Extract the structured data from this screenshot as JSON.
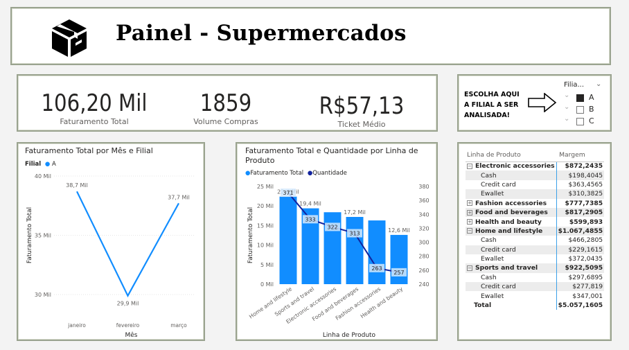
{
  "header": {
    "title": "Painel - Supermercados",
    "logo_icon": "package-box-icon"
  },
  "kpis": [
    {
      "value": "106,20 Mil",
      "label": "Faturamento Total"
    },
    {
      "value": "1859",
      "label": "Volume Compras"
    },
    {
      "value": "R$57,13",
      "label": "Ticket Médio"
    }
  ],
  "filter": {
    "prompt": [
      "ESCOLHA AQUI",
      "A FILIAL A SER",
      "ANALISADA!"
    ],
    "field_label": "Filia...",
    "arrow_icon": "right-arrow-icon",
    "options": [
      {
        "label": "A",
        "checked": true
      },
      {
        "label": "B",
        "checked": false
      },
      {
        "label": "C",
        "checked": false
      }
    ]
  },
  "chart_monthly": {
    "title": "Faturamento Total por Mês e Filial",
    "legend_title": "Filial",
    "legend_item": "A"
  },
  "chart_product": {
    "title_line1": "Faturamento Total e Quantidade por Linha de",
    "title_line2": "Produto",
    "legend_bar": "Faturamento Total",
    "legend_line": "Quantidade"
  },
  "chart_data": [
    {
      "type": "line",
      "title": "Faturamento Total por Mês e Filial",
      "xlabel": "Mês",
      "ylabel": "Faturamento Total",
      "categories": [
        "janeiro",
        "fevereiro",
        "março"
      ],
      "series": [
        {
          "name": "A",
          "values": [
            38.7,
            29.9,
            37.7
          ],
          "labels": [
            "38,7 Mil",
            "29,9 Mil",
            "37,7 Mil"
          ]
        }
      ],
      "ylim": [
        30,
        40
      ],
      "yticks": [
        "30 Mil",
        "35 Mil",
        "40 Mil"
      ],
      "yticks_values": [
        30,
        35,
        40
      ],
      "color": "#118DFF"
    },
    {
      "type": "bar",
      "title": "Faturamento Total e Quantidade por Linha de Produto",
      "xlabel": "Linha de Produto",
      "ylabel": "Faturamento Total",
      "categories": [
        "Home and lifestyle",
        "Sports and travel",
        "Electronic accessories",
        "Food and beverages",
        "Fashion accessories",
        "Health and beauty"
      ],
      "series": [
        {
          "name": "Faturamento Total",
          "values": [
            22.4,
            19.4,
            18.4,
            17.2,
            16.3,
            12.6
          ],
          "labels": [
            "22,4 Mil",
            "19,4 Mil",
            "",
            "17,2 Mil",
            "",
            "12,6 Mil"
          ],
          "color": "#118DFF"
        },
        {
          "name": "Quantidade",
          "values": [
            371,
            333,
            322,
            313,
            263,
            257
          ],
          "axis": "right",
          "color": "#12239E"
        }
      ],
      "ylim": [
        0,
        25
      ],
      "yticks": [
        "0 Mil",
        "5 Mil",
        "10 Mil",
        "15 Mil",
        "20 Mil",
        "25 Mil"
      ],
      "yticks_values": [
        0,
        5,
        10,
        15,
        20,
        25
      ],
      "y2lim": [
        240,
        380
      ],
      "y2ticks": [
        "240",
        "260",
        "280",
        "300",
        "320",
        "340",
        "360",
        "380"
      ],
      "y2ticks_values": [
        240,
        260,
        280,
        300,
        320,
        340,
        360,
        380
      ]
    }
  ],
  "matrix": {
    "headers": [
      "Linha de Produto",
      "Margem"
    ],
    "rows": [
      {
        "kind": "cat",
        "expanded": true,
        "name": "Electronic accessories",
        "value": "$872,2435"
      },
      {
        "kind": "sub",
        "name": "Cash",
        "value": "$198,4045"
      },
      {
        "kind": "sub",
        "name": "Credit card",
        "value": "$363,4565"
      },
      {
        "kind": "sub",
        "name": "Ewallet",
        "value": "$310,3825"
      },
      {
        "kind": "cat",
        "expanded": false,
        "name": "Fashion accessories",
        "value": "$777,7385"
      },
      {
        "kind": "cat",
        "expanded": false,
        "name": "Food and beverages",
        "value": "$817,2905"
      },
      {
        "kind": "cat",
        "expanded": false,
        "name": "Health and beauty",
        "value": "$599,893"
      },
      {
        "kind": "cat",
        "expanded": true,
        "name": "Home and lifestyle",
        "value": "$1.067,4855"
      },
      {
        "kind": "sub",
        "name": "Cash",
        "value": "$466,2805"
      },
      {
        "kind": "sub",
        "name": "Credit card",
        "value": "$229,1615"
      },
      {
        "kind": "sub",
        "name": "Ewallet",
        "value": "$372,0435"
      },
      {
        "kind": "cat",
        "expanded": true,
        "name": "Sports and travel",
        "value": "$922,5095"
      },
      {
        "kind": "sub",
        "name": "Cash",
        "value": "$297,6895"
      },
      {
        "kind": "sub",
        "name": "Credit card",
        "value": "$277,819"
      },
      {
        "kind": "sub",
        "name": "Ewallet",
        "value": "$347,001"
      }
    ],
    "total": {
      "name": "Total",
      "value": "$5.057,1605"
    }
  }
}
